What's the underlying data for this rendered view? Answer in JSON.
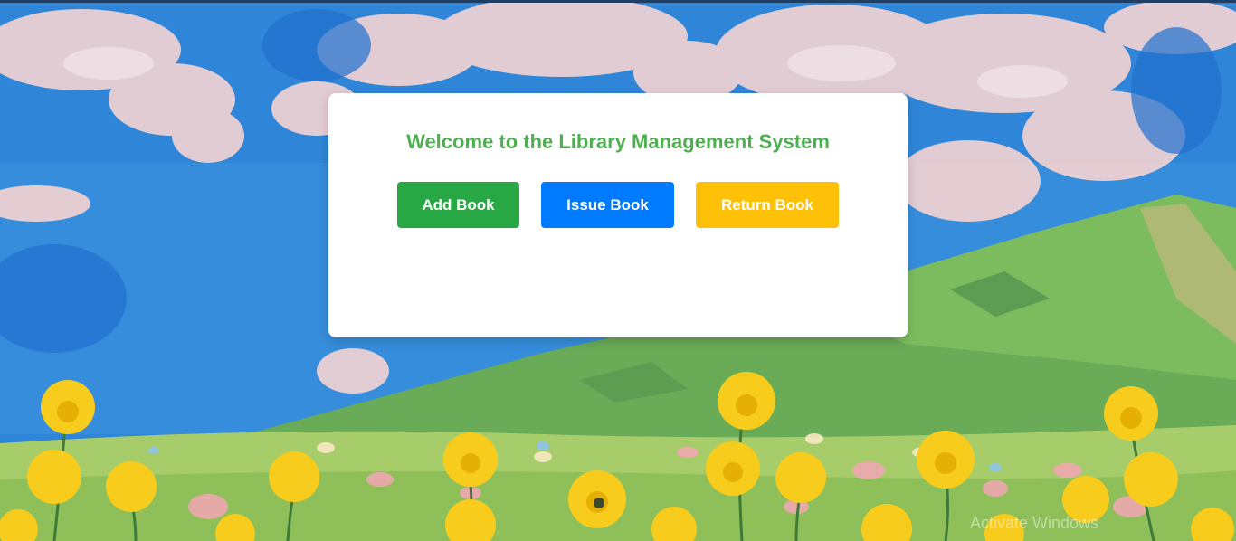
{
  "card": {
    "title": "Welcome to the Library Management System"
  },
  "buttons": {
    "add_book": "Add Book",
    "issue_book": "Issue Book",
    "return_book": "Return Book"
  },
  "colors": {
    "title": "#4caf50",
    "add_book": "#28a745",
    "issue_book": "#007bff",
    "return_book": "#ffc107",
    "sky": "#2f86d8",
    "clouds": "#f2d3d3",
    "mountain": "#6aab57",
    "flowers": "#f7cc1d"
  },
  "background": {
    "description_icon": "landscape-illustration"
  },
  "watermark": {
    "text": "Activate Windows"
  }
}
